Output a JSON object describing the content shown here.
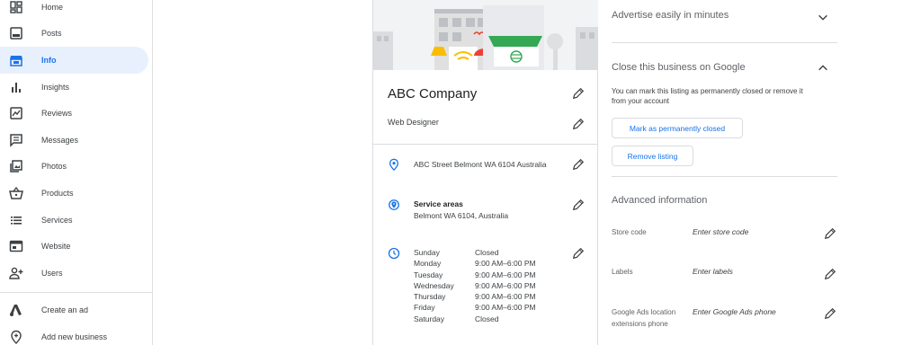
{
  "sidebar": {
    "items": [
      {
        "label": "Home",
        "icon": "dashboard-icon"
      },
      {
        "label": "Posts",
        "icon": "posts-icon"
      },
      {
        "label": "Info",
        "icon": "storefront-icon",
        "active": true
      },
      {
        "label": "Insights",
        "icon": "bar-chart-icon"
      },
      {
        "label": "Reviews",
        "icon": "rate-review-icon"
      },
      {
        "label": "Messages",
        "icon": "chat-icon"
      },
      {
        "label": "Photos",
        "icon": "photo-library-icon"
      },
      {
        "label": "Products",
        "icon": "shopping-basket-icon"
      },
      {
        "label": "Services",
        "icon": "list-icon"
      },
      {
        "label": "Website",
        "icon": "web-icon"
      },
      {
        "label": "Users",
        "icon": "person-add-icon"
      },
      {
        "label": "Create an ad",
        "icon": "google-ads-icon"
      },
      {
        "label": "Add new business",
        "icon": "add-location-icon"
      }
    ]
  },
  "business": {
    "name": "ABC Company",
    "category": "Web Designer",
    "address": "ABC Street Belmont WA 6104 Australia",
    "service_areas_title": "Service areas",
    "service_areas_value": "Belmont WA 6104, Australia",
    "hours": [
      {
        "day": "Sunday",
        "time": "Closed"
      },
      {
        "day": "Monday",
        "time": "9:00 AM–6:00 PM"
      },
      {
        "day": "Tuesday",
        "time": "9:00 AM–6:00 PM"
      },
      {
        "day": "Wednesday",
        "time": "9:00 AM–6:00 PM"
      },
      {
        "day": "Thursday",
        "time": "9:00 AM–6:00 PM"
      },
      {
        "day": "Friday",
        "time": "9:00 AM–6:00 PM"
      },
      {
        "day": "Saturday",
        "time": "Closed"
      }
    ]
  },
  "right": {
    "advertise_title": "Advertise easily in minutes",
    "close_title": "Close this business on Google",
    "close_description": "You can mark this listing as permanently closed or remove it from your account",
    "mark_closed_label": "Mark as permanently closed",
    "remove_label": "Remove listing",
    "advanced_title": "Advanced information",
    "store_code_label": "Store code",
    "store_code_placeholder": "Enter store code",
    "labels_label": "Labels",
    "labels_placeholder": "Enter labels",
    "ads_phone_label": "Google Ads location extensions phone",
    "ads_phone_placeholder": "Enter Google Ads phone"
  },
  "colors": {
    "accent": "#1a73e8",
    "active_bg": "#e8f0fe",
    "divider": "#dadce0",
    "text": "#3c4043"
  }
}
